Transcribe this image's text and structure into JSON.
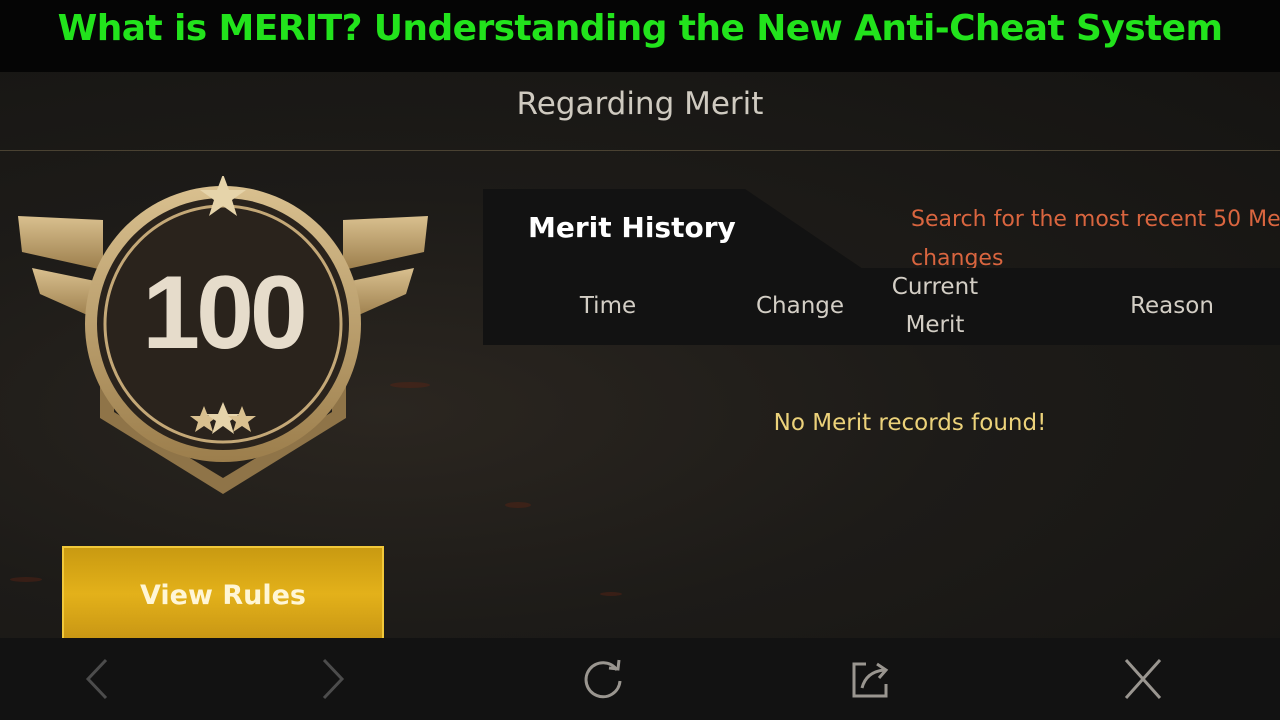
{
  "banner": {
    "title": "What is MERIT? Understanding the New Anti-Cheat System"
  },
  "header": {
    "title": "Regarding Merit"
  },
  "badge": {
    "value": "100",
    "icon": "merit-badge-icon"
  },
  "buttons": {
    "view_rules": "View Rules"
  },
  "history": {
    "tab_label": "Merit History",
    "note": "Search for the most recent 50 Me changes",
    "columns": {
      "time": "Time",
      "change": "Change",
      "current_merit": "Current Merit",
      "reason": "Reason"
    },
    "empty_message": "No Merit records found!"
  },
  "toolbar": {
    "icons": [
      "back-arrow-icon",
      "forward-arrow-icon",
      "refresh-icon",
      "share-icon",
      "close-icon"
    ]
  },
  "colors": {
    "banner_text": "#22e31c",
    "accent_gold": "#e3b11a",
    "note_orange": "#d9653f",
    "empty_yellow": "#ecd27a"
  }
}
